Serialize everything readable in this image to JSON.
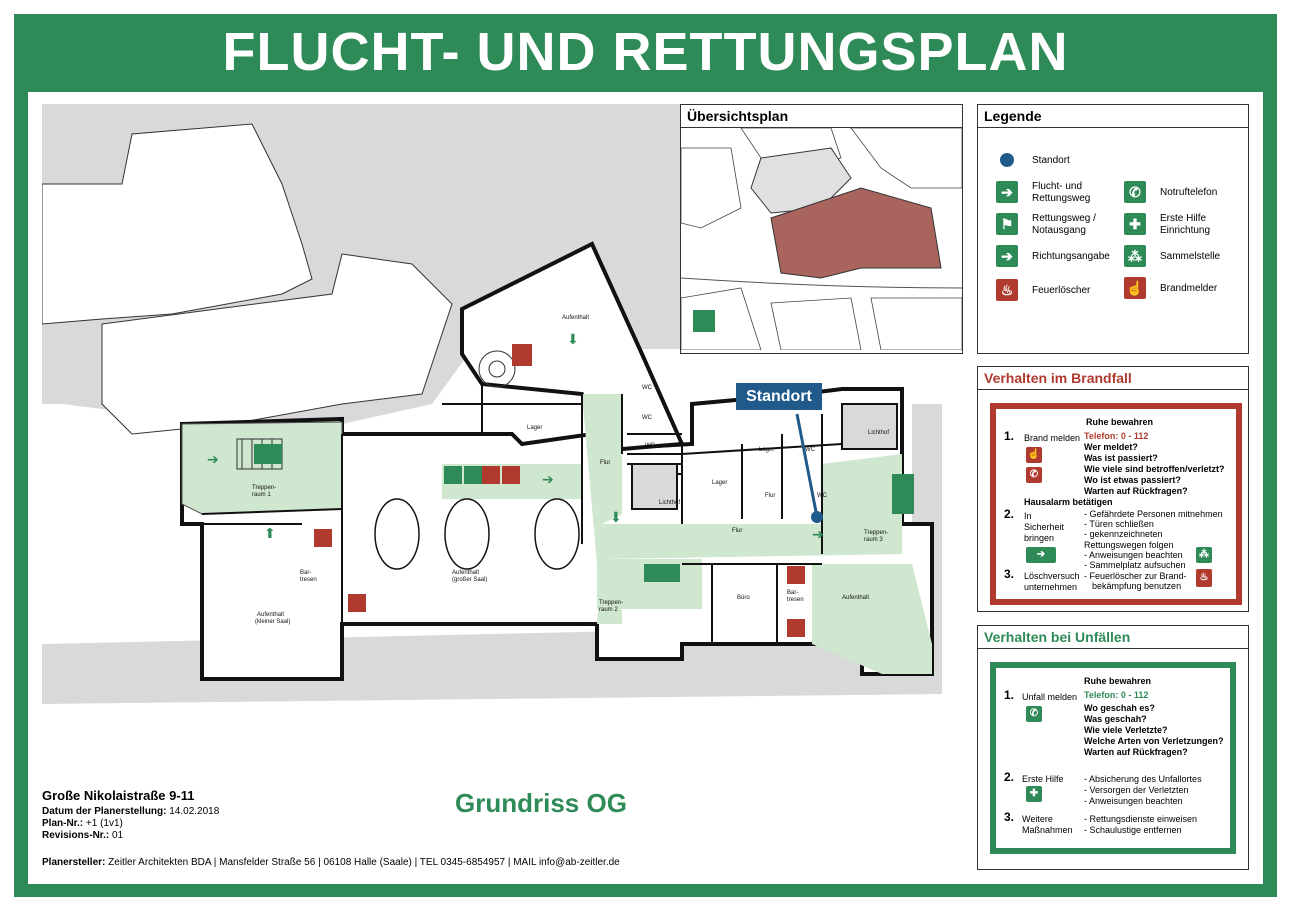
{
  "header": {
    "title": "FLUCHT- UND RETTUNGSPLAN"
  },
  "plan": {
    "rooms": [
      "Aufenthalt",
      "Lager",
      "WC",
      "WC",
      "WC",
      "Flur",
      "Lager",
      "Lichthof",
      "Flur",
      "WC",
      "WC",
      "Lichthof",
      "Treppen-raum 1",
      "Bar-tresen",
      "Aufenthalt (großer Saal)",
      "Treppen-raum 2",
      "Büro",
      "Bar-tresen",
      "Aufenthalt",
      "Treppen-raum 3",
      "Aufenthalt (kleiner Saal)",
      "Flur",
      "Bar-tresen"
    ],
    "standort_label": "Standort",
    "grundriss_label": "Grundriss OG"
  },
  "overview": {
    "title": "Übersichtsplan"
  },
  "legend": {
    "title": "Legende",
    "items": [
      {
        "label": "Standort",
        "icon": "location-dot-icon"
      },
      {
        "label": "Flucht- und Rettungsweg",
        "icon": "escape-arrow-icon"
      },
      {
        "label": "Notruftelefon",
        "icon": "emergency-phone-icon"
      },
      {
        "label": "Rettungsweg / Notausgang",
        "icon": "emergency-exit-icon"
      },
      {
        "label": "Erste Hilfe Einrichtung",
        "icon": "first-aid-icon"
      },
      {
        "label": "Richtungsangabe",
        "icon": "direction-arrow-icon"
      },
      {
        "label": "Sammelstelle",
        "icon": "assembly-point-icon"
      },
      {
        "label": "Feuerlöscher",
        "icon": "fire-extinguisher-icon"
      },
      {
        "label": "Brandmelder",
        "icon": "fire-alarm-icon"
      }
    ]
  },
  "brandfall": {
    "title": "Verhalten im Brandfall",
    "ruhe": "Ruhe bewahren",
    "s1_label": "Brand melden",
    "s1_tel": "Telefon: 0 - 112",
    "s1_lines": [
      "Wer meldet?",
      "Was ist passiert?",
      "Wie viele sind betroffen/verletzt?",
      "Wo ist etwas passiert?",
      "Warten auf Rückfragen?"
    ],
    "hausalarm": "Hausalarm betätigen",
    "s2_label": "In Sicherheit bringen",
    "s2_lines": [
      "- Gefährdete Personen mitnehmen",
      "- Türen schließen",
      "- gekennzeichneten Rettungswegen folgen",
      "- Anweisungen beachten",
      "- Sammelplatz aufsuchen"
    ],
    "s3_label": "Löschversuch unternehmen",
    "s3_lines": [
      "- Feuerlöscher zur Brand-",
      "bekämpfung benutzen"
    ]
  },
  "unfaelle": {
    "title": "Verhalten bei Unfällen",
    "ruhe": "Ruhe bewahren",
    "s1_label": "Unfall melden",
    "s1_tel": "Telefon: 0 - 112",
    "s1_lines": [
      "Wo geschah es?",
      "Was geschah?",
      "Wie viele Verletzte?",
      "Welche Arten von Verletzungen?",
      "Warten auf Rückfragen?"
    ],
    "s2_label": "Erste Hilfe",
    "s2_lines": [
      "- Absicherung des Unfallortes",
      "- Versorgen der Verletzten",
      "- Anweisungen beachten"
    ],
    "s3_label": "Weitere Maßnahmen",
    "s3_lines": [
      "- Rettungsdienste einweisen",
      "- Schaulustige entfernen"
    ]
  },
  "footer": {
    "address": "Große Nikolaistraße 9-11",
    "datum_label": "Datum der Planerstellung:",
    "datum": "14.02.2018",
    "plan_label": "Plan-Nr.:",
    "plan_nr": "+1 (1v1)",
    "rev_label": "Revisions-Nr.:",
    "rev_nr": "01",
    "planersteller_label": "Planersteller:",
    "planersteller": "Zeitler Architekten BDA | Mansfelder Straße 56 | 06108 Halle (Saale) | TEL 0345-6854957 | MAIL info@ab-zeitler.de"
  },
  "colors": {
    "green": "#2e8b57",
    "red": "#b03a2e",
    "blue": "#1f5a8a",
    "route": "#cfe6cf"
  }
}
